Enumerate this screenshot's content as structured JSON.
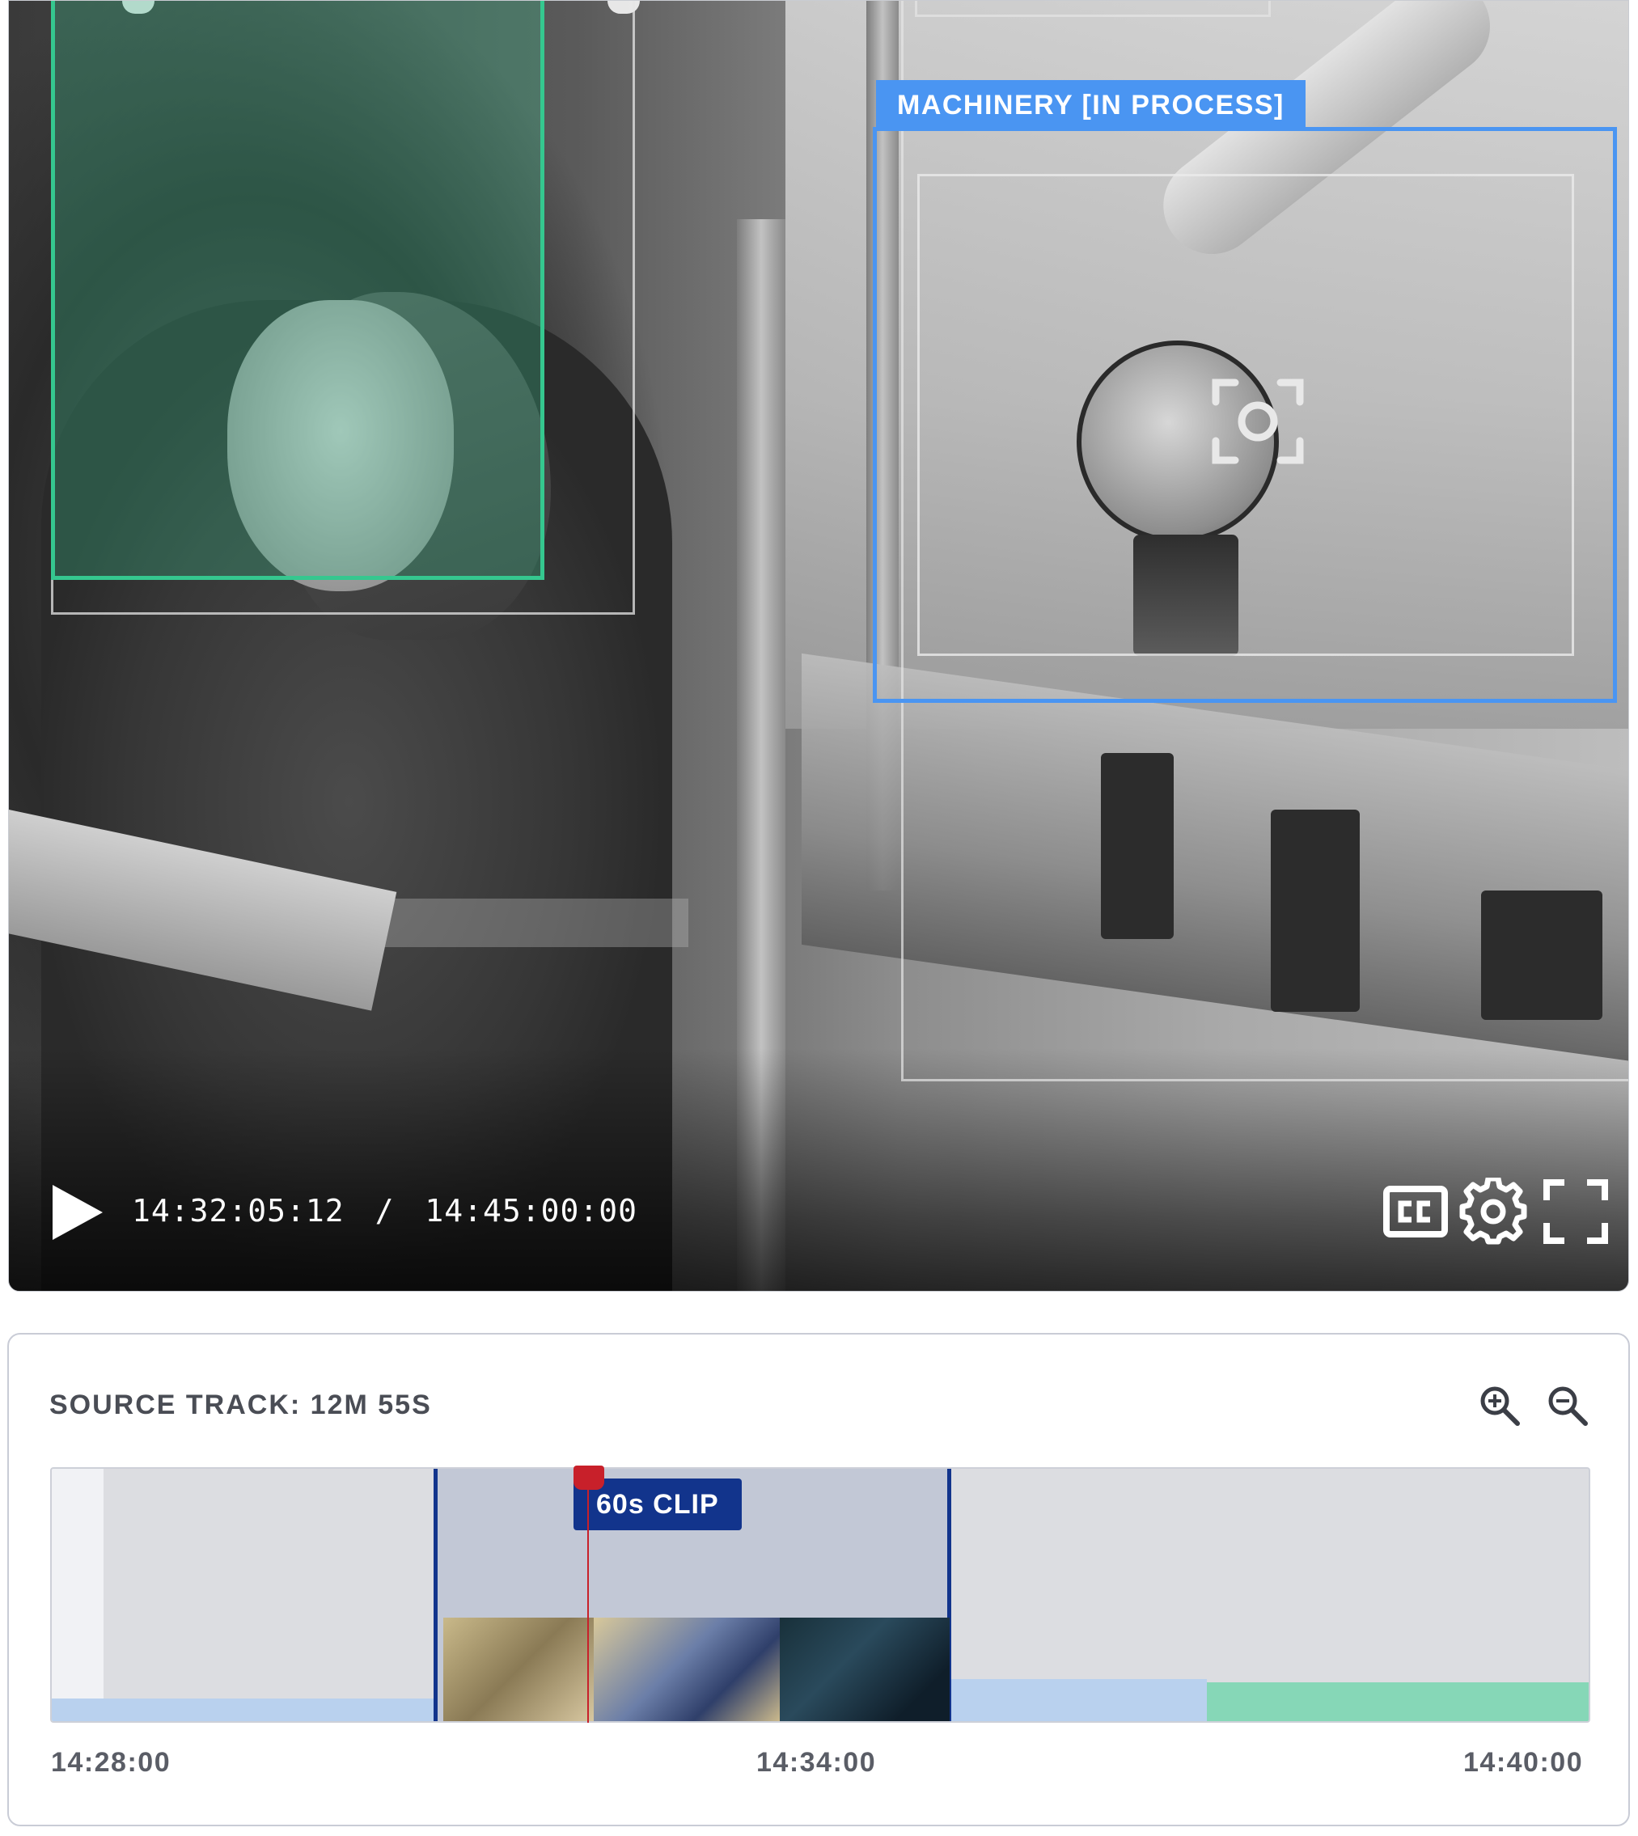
{
  "player": {
    "detection_label": "MACHINERY [IN PROCESS]",
    "current_time": "14:32:05:12",
    "separator": "/",
    "total_time": "14:45:00:00",
    "controls": [
      "play-icon",
      "closed-captions-icon",
      "settings-gear-icon",
      "fullscreen-icon"
    ],
    "colors": {
      "person_box": "#35c78f",
      "machinery_box": "#4a95f2"
    }
  },
  "timeline": {
    "title": "SOURCE TRACK: 12M 55S",
    "zoom_in_icon": "zoom-in-icon",
    "zoom_out_icon": "zoom-out-icon",
    "clip_label": "60s CLIP",
    "ticks": [
      "14:28:00",
      "14:34:00",
      "14:40:00"
    ],
    "colors": {
      "selection_border": "#12348c",
      "playhead": "#c8202a",
      "lane_blue": "#b9d1ee",
      "lane_green": "#86d7b7"
    }
  }
}
